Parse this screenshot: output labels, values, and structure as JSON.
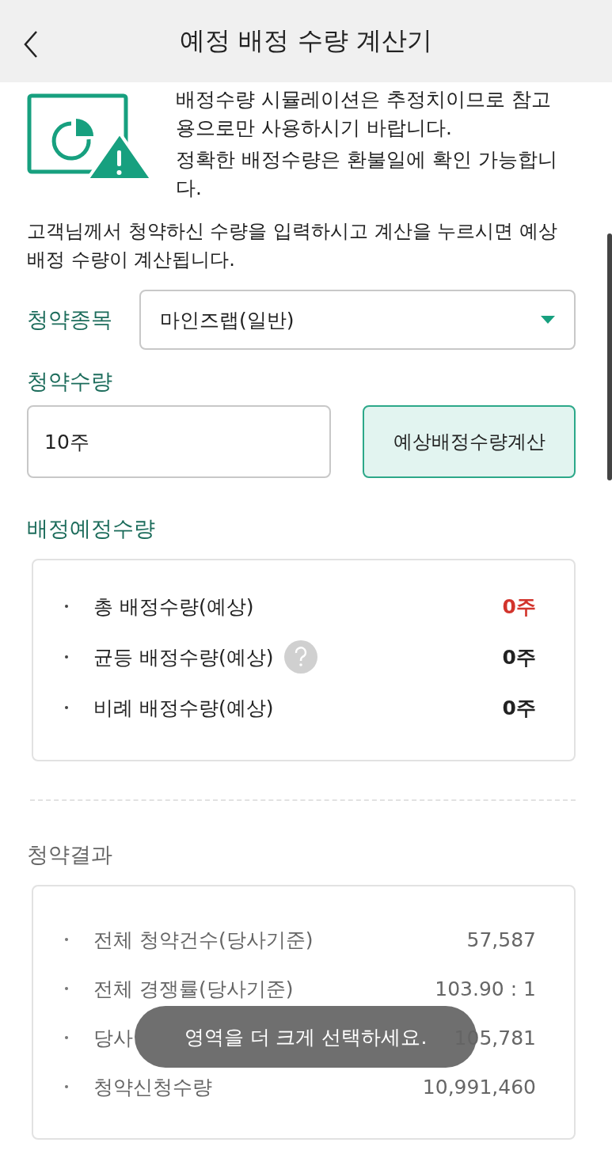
{
  "header": {
    "title": "예정 배정 수량 계산기"
  },
  "notices": [
    "배정수량 시뮬레이션은 추정치이므로 참고용으로만 사용하시기 바랍니다.",
    "정확한 배정수량은 환불일에 확인 가능합니다."
  ],
  "instruction": "고객님께서 청약하신 수량을 입력하시고 계산을 누르시면 예상 배정 수량이 계산됩니다.",
  "stock_select": {
    "label": "청약종목",
    "value": "마인즈랩(일반)"
  },
  "quantity": {
    "label": "청약수량",
    "value": "10주"
  },
  "calculate_button": "예상배정수량계산",
  "allocation": {
    "title": "배정예정수량",
    "rows": [
      {
        "label": "총 배정수량(예상)",
        "value": "0주",
        "highlight": true,
        "help": false
      },
      {
        "label": "균등 배정수량(예상)",
        "value": "0주",
        "highlight": false,
        "help": true
      },
      {
        "label": "비례 배정수량(예상)",
        "value": "0주",
        "highlight": false,
        "help": false
      }
    ]
  },
  "results": {
    "title": "청약결과",
    "rows": [
      {
        "label": "전체 청약건수(당사기준)",
        "value": "57,587"
      },
      {
        "label": "전체 경쟁률(당사기준)",
        "value": "103.90  : 1"
      },
      {
        "label": "당사",
        "value": "105,781"
      },
      {
        "label": "청약신청수량",
        "value": "10,991,460"
      }
    ]
  },
  "toast": "영역을 더 크게 선택하세요."
}
